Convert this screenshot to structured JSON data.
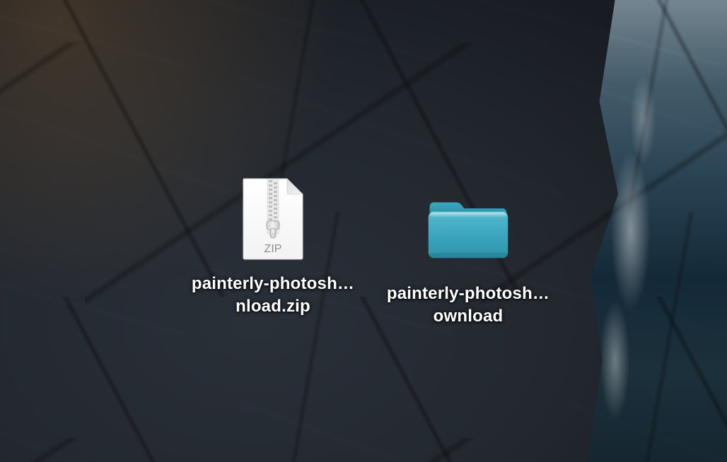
{
  "desktop": {
    "items": [
      {
        "kind": "zip",
        "icon": "zip-archive-icon",
        "badge": "ZIP",
        "label": "painterly-photosh…nload.zip"
      },
      {
        "kind": "folder",
        "icon": "folder-icon",
        "label": "painterly-photosh…ownload"
      }
    ]
  }
}
